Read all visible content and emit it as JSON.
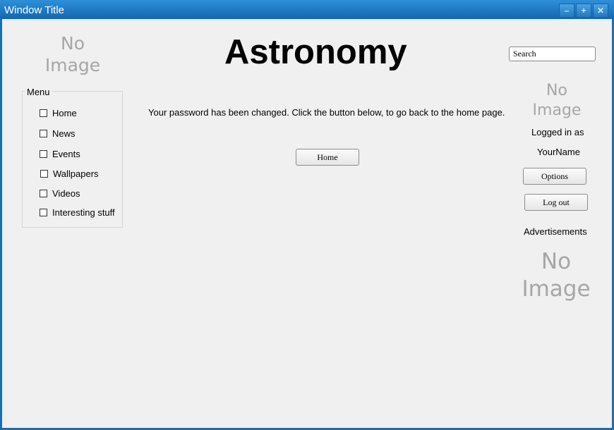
{
  "window": {
    "title": "Window Title",
    "minimize_glyph": "–",
    "maximize_glyph": "+",
    "close_glyph": "✕"
  },
  "logo": {
    "line1": "No",
    "line2": "Image"
  },
  "header": {
    "title": "Astronomy"
  },
  "search": {
    "placeholder": "Search"
  },
  "menu": {
    "legend": "Menu",
    "items": [
      {
        "label": "Home"
      },
      {
        "label": "News"
      },
      {
        "label": "Events"
      },
      {
        "label": "Wallpapers"
      },
      {
        "label": "Videos"
      },
      {
        "label": "Interesting stuff"
      }
    ]
  },
  "main": {
    "message": "Your password has been changed. Click the button below, to go back to the home page.",
    "home_button": "Home"
  },
  "user": {
    "avatar_line1": "No",
    "avatar_line2": "Image",
    "logged_in_as": "Logged in as",
    "name": "YourName",
    "options_button": "Options",
    "logout_button": "Log out"
  },
  "ads": {
    "heading": "Advertisements",
    "image_line1": "No",
    "image_line2": "Image"
  },
  "colors": {
    "titlebar": "#1a6fb0",
    "background": "#f0f0f0",
    "placeholder_text": "#a6a6a6"
  }
}
